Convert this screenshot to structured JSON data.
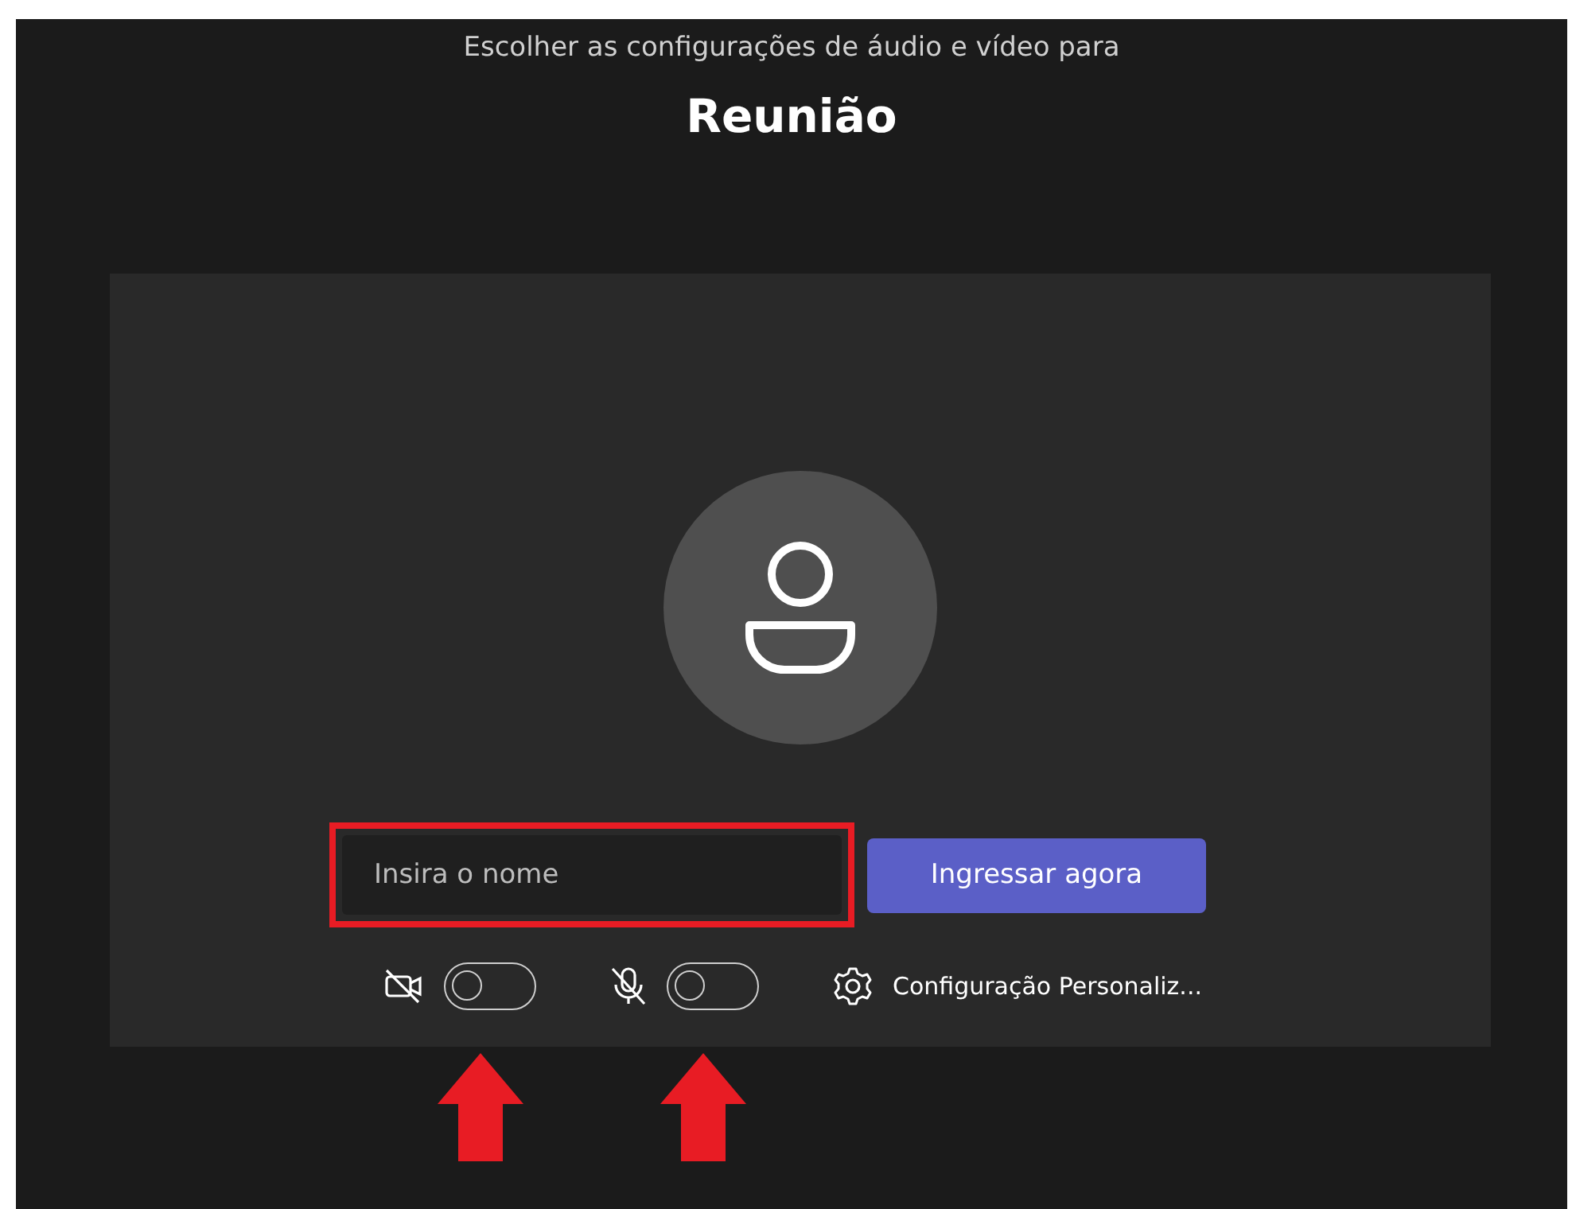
{
  "header": {
    "subtitle": "Escolher as configurações de áudio e vídeo para",
    "title": "Reunião"
  },
  "name_field": {
    "placeholder": "Insira o nome",
    "highlighted": true
  },
  "join_button": {
    "label": "Ingressar agora"
  },
  "toggles": [
    {
      "kind": "camera",
      "on": false,
      "pointed": true
    },
    {
      "kind": "mic",
      "on": false,
      "pointed": true
    }
  ],
  "settings_link": {
    "label": "Configuração Personaliz..."
  }
}
